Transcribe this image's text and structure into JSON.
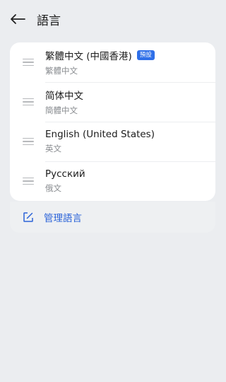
{
  "header": {
    "title": "語言"
  },
  "languages": [
    {
      "name": "繁體中文 (中國香港)",
      "native": "繁體中文",
      "badge": "預設"
    },
    {
      "name": "简体中文",
      "native": "簡體中文"
    },
    {
      "name": "English (United States)",
      "native": "英文"
    },
    {
      "name": "Русский",
      "native": "俄文"
    }
  ],
  "manage": {
    "label": "管理語言"
  },
  "colors": {
    "accent": "#2b63d8",
    "badge": "#2f6fe8",
    "background": "#ebedf0"
  }
}
